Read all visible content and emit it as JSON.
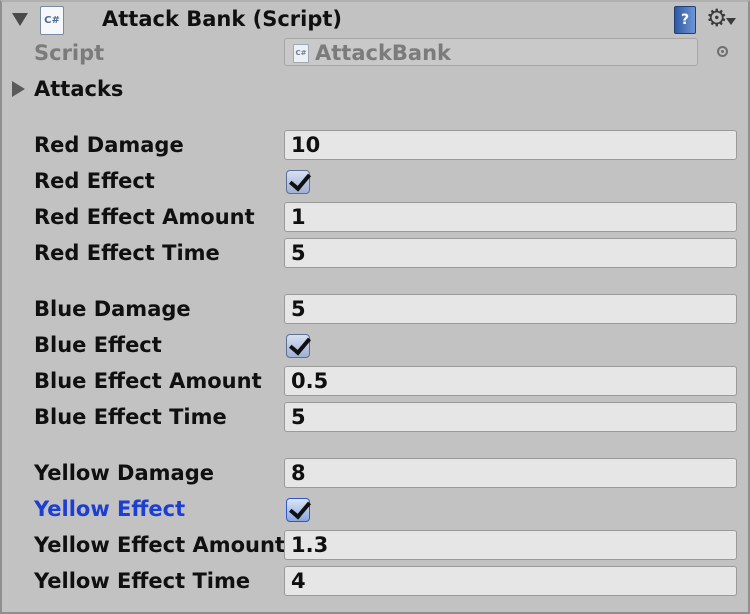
{
  "component": {
    "title": "Attack Bank (Script)",
    "icon": "csharp-script-icon"
  },
  "script": {
    "label": "Script",
    "value": "AttackBank"
  },
  "attacks": {
    "label": "Attacks",
    "expanded": false
  },
  "properties": {
    "red_damage": {
      "label": "Red Damage",
      "value": "10"
    },
    "red_effect": {
      "label": "Red Effect",
      "checked": true
    },
    "red_effect_amount": {
      "label": "Red Effect Amount",
      "value": "1"
    },
    "red_effect_time": {
      "label": "Red Effect Time",
      "value": "5"
    },
    "blue_damage": {
      "label": "Blue Damage",
      "value": "5"
    },
    "blue_effect": {
      "label": "Blue Effect",
      "checked": true
    },
    "blue_effect_amount": {
      "label": "Blue Effect Amount",
      "value": "0.5"
    },
    "blue_effect_time": {
      "label": "Blue Effect Time",
      "value": "5"
    },
    "yellow_damage": {
      "label": "Yellow Damage",
      "value": "8"
    },
    "yellow_effect": {
      "label": "Yellow Effect",
      "checked": true,
      "focused": true
    },
    "yellow_effect_amount": {
      "label": "Yellow Effect Amount",
      "value": "1.3"
    },
    "yellow_effect_time": {
      "label": "Yellow Effect Time",
      "value": "4"
    }
  },
  "colors": {
    "background": "#c2c2c2",
    "focused_label": "#1c3ed1"
  }
}
